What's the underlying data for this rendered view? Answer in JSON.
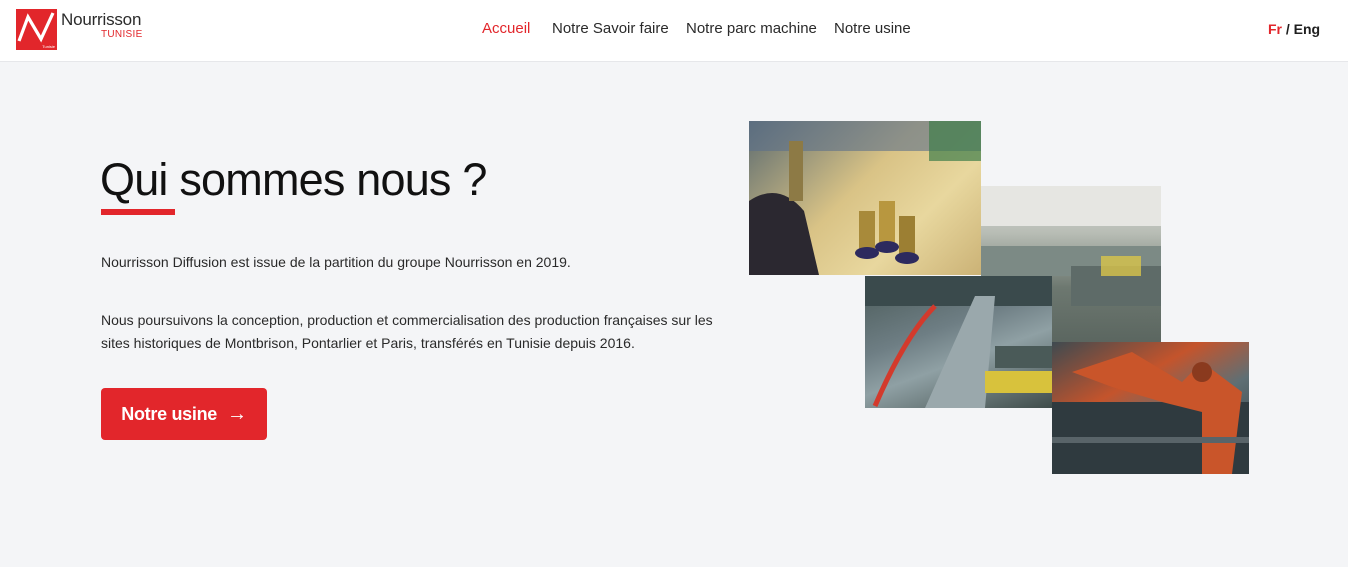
{
  "brand": {
    "name": "Nourrisson",
    "subtitle": "TUNISIE",
    "mark_caption": "Tunisie",
    "accent": "#e2262b"
  },
  "nav": {
    "items": [
      {
        "label": "Accueil",
        "active": true
      },
      {
        "label": "Notre Savoir faire",
        "active": false
      },
      {
        "label": "Notre parc machine",
        "active": false
      },
      {
        "label": "Notre usine",
        "active": false
      }
    ]
  },
  "lang": {
    "fr": "Fr",
    "separator": "/",
    "en": "Eng"
  },
  "hero": {
    "title": "Qui sommes nous ?",
    "paragraph1": "Nourrisson Diffusion est issue de la partition du groupe Nourrisson en 2019.",
    "paragraph2": "Nous poursuivons la conception, production et commercialisation des production françaises sur les sites historiques de Montbrison, Pontarlier et Paris, transférés en Tunisie depuis 2016.",
    "cta_label": "Notre usine",
    "cta_arrow": "→"
  },
  "gallery": {
    "photos": [
      {
        "subject": "brass-fittings-photo"
      },
      {
        "subject": "factory-hall-photo"
      },
      {
        "subject": "production-line-photo"
      },
      {
        "subject": "industrial-robot-photo"
      }
    ]
  }
}
